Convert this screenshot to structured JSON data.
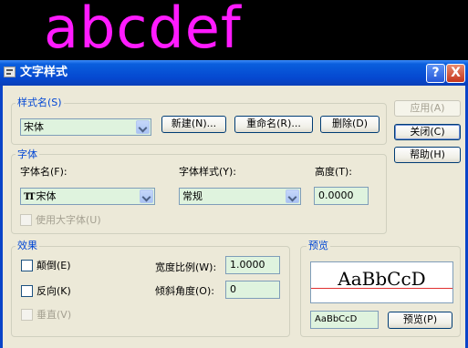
{
  "background_text": "abcdef",
  "window": {
    "title": "文字样式",
    "help_button": "?",
    "close_button": "X"
  },
  "style_name": {
    "group_label": "样式名(S)",
    "selected": "宋体",
    "new_button": "新建(N)...",
    "rename_button": "重命名(R)...",
    "delete_button": "删除(D)"
  },
  "side_buttons": {
    "apply": "应用(A)",
    "close": "关闭(C)",
    "help": "帮助(H)"
  },
  "font": {
    "group_label": "字体",
    "font_name_label": "字体名(F):",
    "font_name_value": "宋体",
    "font_name_icon": "truetype-icon",
    "font_style_label": "字体样式(Y):",
    "font_style_value": "常规",
    "height_label": "高度(T):",
    "height_value": "0.0000",
    "bigfont_label": "使用大字体(U)"
  },
  "effects": {
    "group_label": "效果",
    "upside_down_label": "颠倒(E)",
    "backwards_label": "反向(K)",
    "vertical_label": "垂直(V)",
    "width_factor_label": "宽度比例(W):",
    "width_factor_value": "1.0000",
    "oblique_angle_label": "倾斜角度(O):",
    "oblique_angle_value": "0"
  },
  "preview": {
    "group_label": "预览",
    "sample_text": "AaBbCcD",
    "input_value": "AaBbCcD",
    "preview_button": "预览(P)"
  },
  "colors": {
    "cad_text": "#ff1bff",
    "titlebar": "#0548d0",
    "dialog_bg": "#ece9d8",
    "group_label": "#0046d5",
    "field_bg": "#dff3de",
    "preview_line": "#e03030"
  }
}
